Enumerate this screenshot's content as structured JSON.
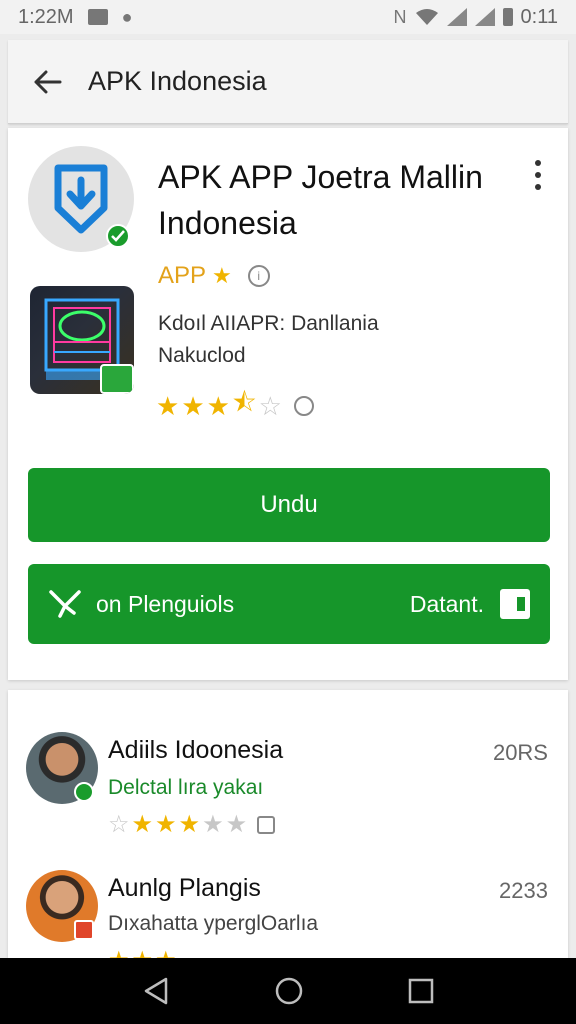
{
  "status_bar": {
    "time": "1:22M",
    "battery_time": "0:11",
    "icons": [
      "message-icon",
      "notification-icon",
      "nfc-icon",
      "wifi-icon",
      "signal-icon",
      "signal-icon",
      "battery-icon"
    ]
  },
  "app_bar": {
    "title": "APK Indonesia"
  },
  "app": {
    "title": "APK APP Joetra Mallin Indonesia",
    "tag": "APP",
    "description": "Kdoıl AIIAPR: Danllania Nakuclod",
    "rating": 3.5
  },
  "buttons": {
    "install": "Undu",
    "secondary_left": "on Plenguiols",
    "secondary_right": "Datant."
  },
  "reviews": [
    {
      "name": "Adiils Idoonesia",
      "date": "20RS",
      "text": "Delctal lıra yakaı",
      "text_color": "#1a8a2a",
      "stars": 3
    },
    {
      "name": "Aunlg Plangis",
      "date": "2233",
      "text": "Dıxahatta yperglOarlıa",
      "text_color": "#444444",
      "stars": 3
    }
  ],
  "colors": {
    "accent": "#16962a",
    "star": "#f0b400"
  }
}
